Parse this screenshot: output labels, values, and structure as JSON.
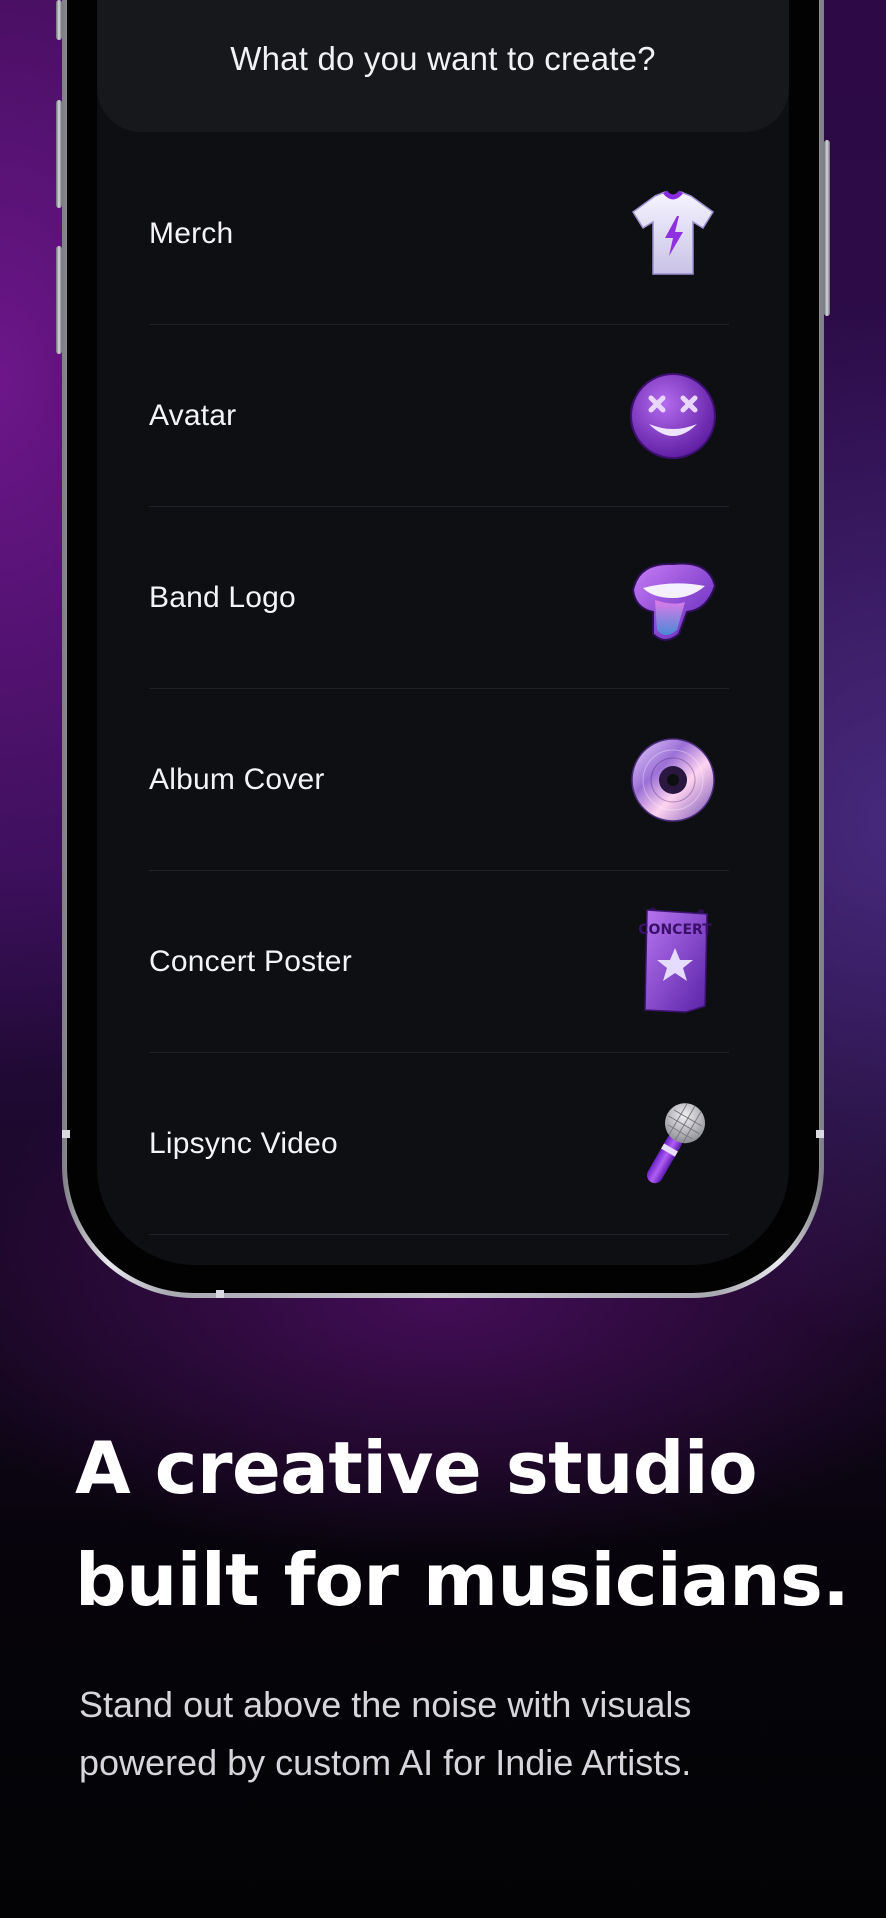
{
  "app": {
    "header_title": "What do you want to create?",
    "accent_color": "#7a2fd0",
    "background_color": "#0e0f12"
  },
  "menu": {
    "items": [
      {
        "label": "Merch",
        "icon": "tshirt-icon"
      },
      {
        "label": "Avatar",
        "icon": "smiley-face-icon"
      },
      {
        "label": "Band Logo",
        "icon": "tongue-logo-icon"
      },
      {
        "label": "Album Cover",
        "icon": "vinyl-disc-icon"
      },
      {
        "label": "Concert Poster",
        "icon": "concert-poster-icon"
      },
      {
        "label": "Lipsync Video",
        "icon": "microphone-icon"
      }
    ]
  },
  "marketing": {
    "headline_line1": "A creative studio",
    "headline_line2": "built for musicians.",
    "subtext_line1": "Stand out above the noise with visuals",
    "subtext_line2": "powered by custom AI for Indie Artists."
  },
  "icon_text": {
    "poster_text": "CONCERT"
  }
}
